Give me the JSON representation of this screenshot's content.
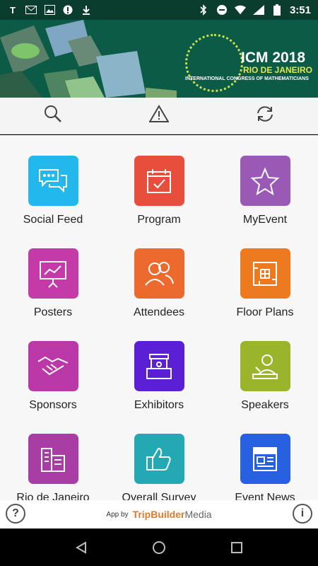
{
  "status_bar": {
    "time": "3:51",
    "left_icons": [
      "t-icon",
      "gmail-icon",
      "image-icon",
      "alert-icon",
      "download-icon"
    ],
    "right_icons": [
      "bluetooth-icon",
      "dnd-icon",
      "wifi-icon",
      "signal-icon",
      "battery-icon"
    ]
  },
  "banner": {
    "title": "ICM 2018",
    "subtitle": "RIO DE JANEIRO",
    "tagline": "INTERNATIONAL CONGRESS OF MATHEMATICIANS"
  },
  "toolbar": {
    "icons": [
      "search-icon",
      "alert-icon",
      "sync-icon"
    ]
  },
  "tiles": [
    {
      "label": "Social Feed",
      "color": "#22b8ee",
      "icon": "chat-icon"
    },
    {
      "label": "Program",
      "color": "#e84e3c",
      "icon": "calendar-check-icon"
    },
    {
      "label": "MyEvent",
      "color": "#9b59b6",
      "icon": "star-icon"
    },
    {
      "label": "Posters",
      "color": "#c43aa7",
      "icon": "presentation-icon"
    },
    {
      "label": "Attendees",
      "color": "#ec6a2e",
      "icon": "people-icon"
    },
    {
      "label": "Floor Plans",
      "color": "#ee7a1f",
      "icon": "floorplan-icon"
    },
    {
      "label": "Sponsors",
      "color": "#bb38a8",
      "icon": "handshake-icon"
    },
    {
      "label": "Exhibitors",
      "color": "#5b1fd6",
      "icon": "booth-icon"
    },
    {
      "label": "Speakers",
      "color": "#9ab52b",
      "icon": "speaker-icon"
    },
    {
      "label": "Rio de Janeiro",
      "color": "#a83ea4",
      "icon": "city-icon"
    },
    {
      "label": "Overall Survey",
      "color": "#22a9b4",
      "icon": "thumbs-up-icon"
    },
    {
      "label": "Event News",
      "color": "#2760e0",
      "icon": "news-icon"
    }
  ],
  "footer": {
    "app_by": "App by",
    "brand_a": "TripBuilder",
    "brand_b": "Media",
    "help": "?",
    "info": "i"
  },
  "colors": {
    "banner_bg": "#0b5b47",
    "status_bg": "#0b3d2e",
    "brand_orange": "#e07a2f"
  }
}
